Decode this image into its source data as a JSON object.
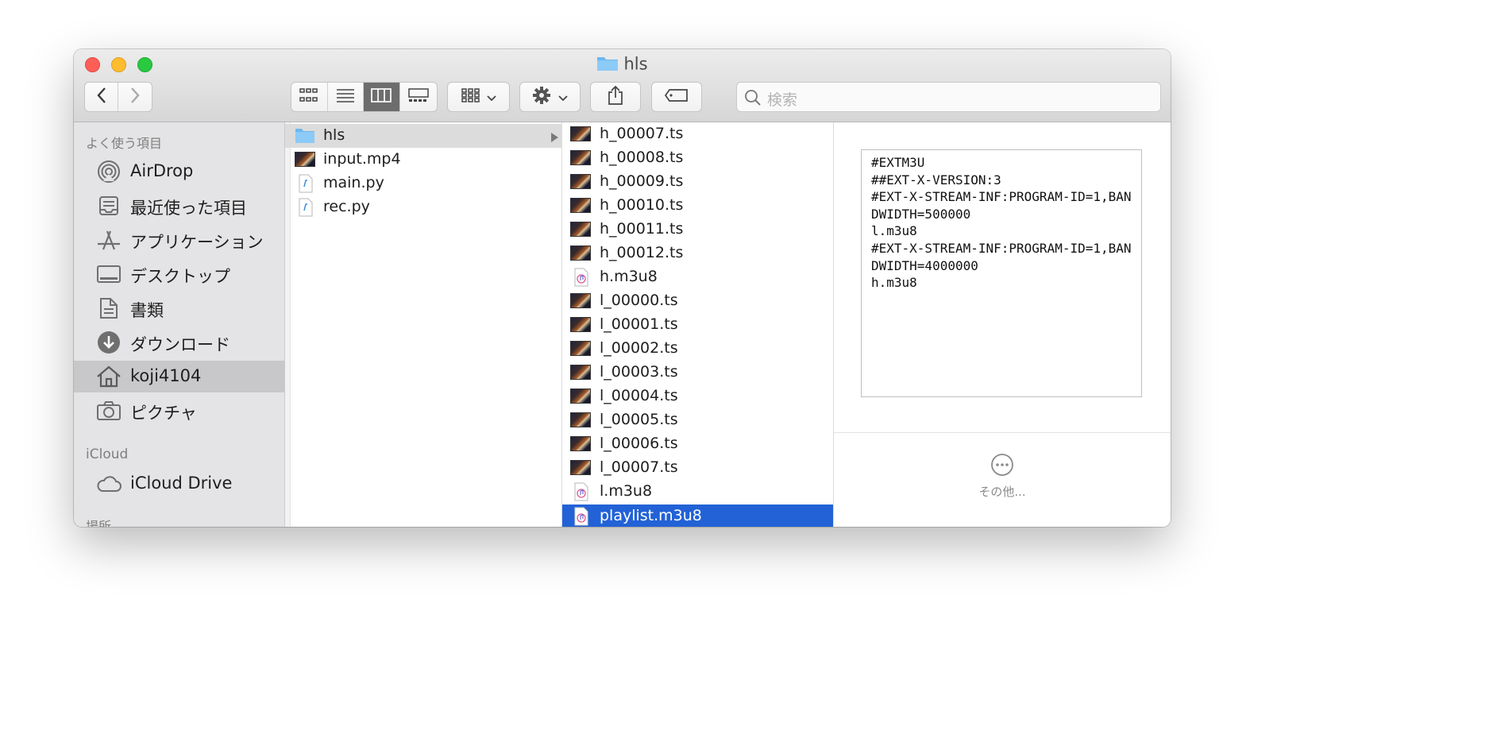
{
  "window": {
    "title": "hls"
  },
  "toolbar": {
    "back_icon": "chevron-left-icon",
    "forward_icon": "chevron-right-icon",
    "view_modes": [
      "icon-view",
      "list-view",
      "column-view",
      "gallery-view"
    ],
    "active_view": "column-view",
    "search_placeholder": "検索"
  },
  "sidebar": {
    "favorites_header": "よく使う項目",
    "favorites": [
      {
        "label": "AirDrop",
        "icon": "airdrop-icon"
      },
      {
        "label": "最近使った項目",
        "icon": "recents-icon"
      },
      {
        "label": "アプリケーション",
        "icon": "applications-icon"
      },
      {
        "label": "デスクトップ",
        "icon": "desktop-icon"
      },
      {
        "label": "書類",
        "icon": "documents-icon"
      },
      {
        "label": "ダウンロード",
        "icon": "downloads-icon"
      },
      {
        "label": "koji4104",
        "icon": "home-icon",
        "selected": true
      },
      {
        "label": "ピクチャ",
        "icon": "pictures-icon"
      }
    ],
    "icloud_header": "iCloud",
    "icloud": [
      {
        "label": "iCloud Drive",
        "icon": "cloud-icon"
      }
    ],
    "locations_header": "場所"
  },
  "column1": {
    "items": [
      {
        "name": "hls",
        "kind": "folder",
        "highlighted": true
      },
      {
        "name": "input.mp4",
        "kind": "video"
      },
      {
        "name": "main.py",
        "kind": "script"
      },
      {
        "name": "rec.py",
        "kind": "script"
      }
    ]
  },
  "column2": {
    "items": [
      {
        "name": "h_00007.ts",
        "kind": "video"
      },
      {
        "name": "h_00008.ts",
        "kind": "video"
      },
      {
        "name": "h_00009.ts",
        "kind": "video"
      },
      {
        "name": "h_00010.ts",
        "kind": "video"
      },
      {
        "name": "h_00011.ts",
        "kind": "video"
      },
      {
        "name": "h_00012.ts",
        "kind": "video"
      },
      {
        "name": "h.m3u8",
        "kind": "playlist"
      },
      {
        "name": "l_00000.ts",
        "kind": "video"
      },
      {
        "name": "l_00001.ts",
        "kind": "video"
      },
      {
        "name": "l_00002.ts",
        "kind": "video"
      },
      {
        "name": "l_00003.ts",
        "kind": "video"
      },
      {
        "name": "l_00004.ts",
        "kind": "video"
      },
      {
        "name": "l_00005.ts",
        "kind": "video"
      },
      {
        "name": "l_00006.ts",
        "kind": "video"
      },
      {
        "name": "l_00007.ts",
        "kind": "video"
      },
      {
        "name": "l.m3u8",
        "kind": "playlist"
      },
      {
        "name": "playlist.m3u8",
        "kind": "playlist",
        "selected": true
      }
    ]
  },
  "preview": {
    "content": "#EXTM3U\n##EXT-X-VERSION:3\n#EXT-X-STREAM-INF:PROGRAM-ID=1,BANDWIDTH=500000\nl.m3u8\n#EXT-X-STREAM-INF:PROGRAM-ID=1,BANDWIDTH=4000000\nh.m3u8",
    "more_label": "その他..."
  },
  "colors": {
    "selection": "#2262d6",
    "sidebar_bg": "#e4e4e6",
    "traffic_red": "#fd5f57",
    "traffic_yellow": "#febc2e",
    "traffic_green": "#29c940"
  }
}
